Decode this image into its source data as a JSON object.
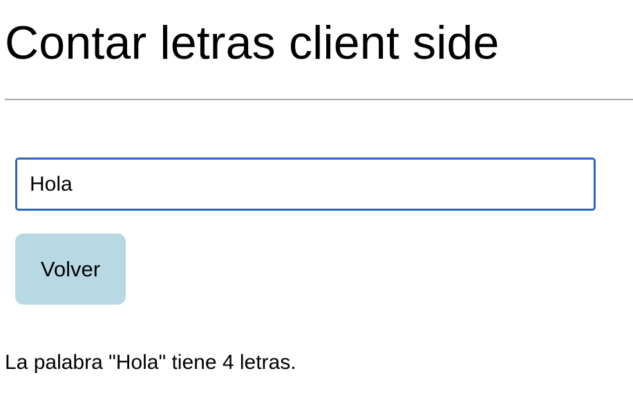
{
  "page": {
    "title": "Contar letras client side"
  },
  "form": {
    "input_value": "Hola",
    "back_button_label": "Volver"
  },
  "result": {
    "text": "La palabra \"Hola\" tiene 4 letras."
  },
  "colors": {
    "input_border": "#2f63c1",
    "button_background": "#b8d8e4",
    "divider": "#a9a9a9"
  }
}
